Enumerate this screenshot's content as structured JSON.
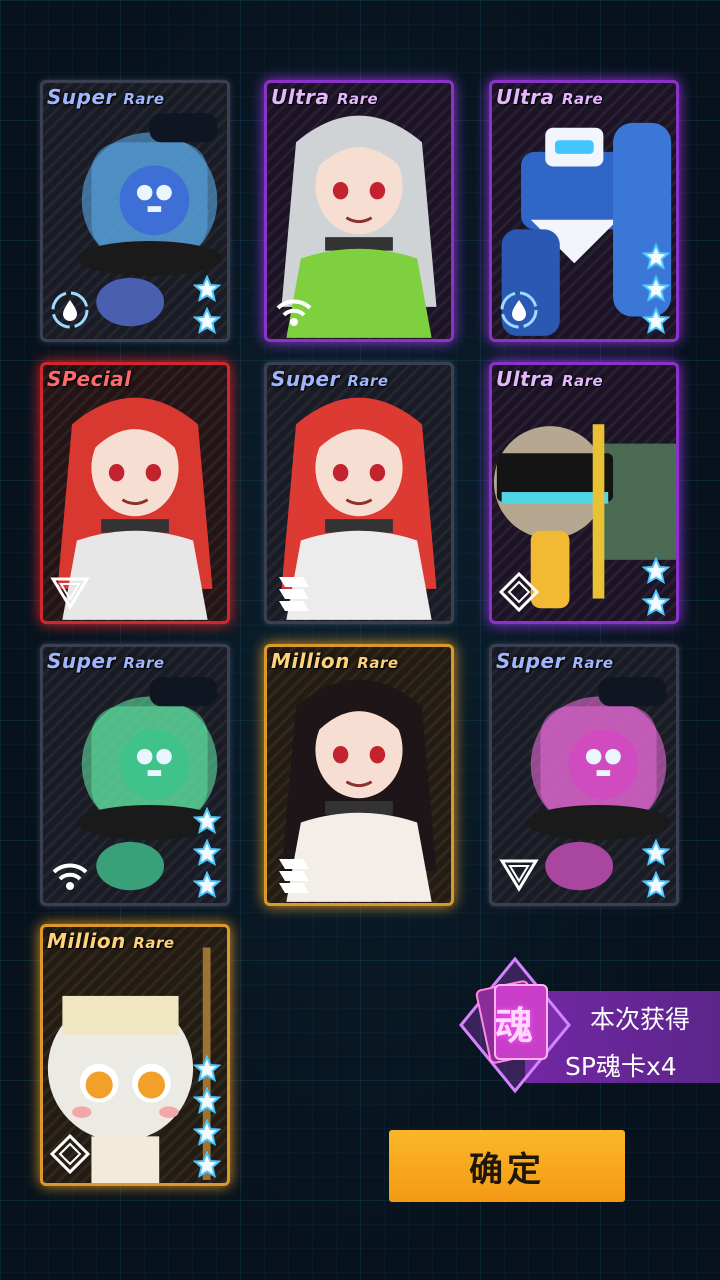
{
  "cards": [
    {
      "rarity_main": "Super",
      "rarity_sub": "Rare",
      "tier": "sr",
      "element_icon": "water-drop-ring-icon",
      "stars": 2,
      "character": "blue-slime-mascot"
    },
    {
      "rarity_main": "Ultra",
      "rarity_sub": "Rare",
      "tier": "ur",
      "element_icon": "wifi-signal-icon",
      "stars": 0,
      "character": "silver-hair-girl"
    },
    {
      "rarity_main": "Ultra",
      "rarity_sub": "Rare",
      "tier": "ur",
      "element_icon": "water-drop-ring-icon",
      "stars": 3,
      "character": "blue-mech"
    },
    {
      "rarity_main": "SPecial",
      "rarity_sub": "",
      "tier": "sp",
      "element_icon": "triangle-down-icon",
      "stars": 0,
      "character": "red-twin-tail-girl"
    },
    {
      "rarity_main": "Super",
      "rarity_sub": "Rare",
      "tier": "sr",
      "element_icon": "striped-banner-icon",
      "stars": 0,
      "character": "red-hair-girl"
    },
    {
      "rarity_main": "Ultra",
      "rarity_sub": "Rare",
      "tier": "ur",
      "element_icon": "diamond-icon",
      "stars": 2,
      "character": "visor-chibi"
    },
    {
      "rarity_main": "Super",
      "rarity_sub": "Rare",
      "tier": "sr",
      "element_icon": "wifi-signal-icon",
      "stars": 3,
      "character": "green-slime-mascot"
    },
    {
      "rarity_main": "Million",
      "rarity_sub": "Rare",
      "tier": "mr",
      "element_icon": "striped-banner-icon",
      "stars": 0,
      "character": "black-hair-girl"
    },
    {
      "rarity_main": "Super",
      "rarity_sub": "Rare",
      "tier": "sr",
      "element_icon": "triangle-down-icon",
      "stars": 2,
      "character": "pink-slime-mascot"
    },
    {
      "rarity_main": "Million",
      "rarity_sub": "Rare",
      "tier": "mr",
      "element_icon": "diamond-icon",
      "stars": 4,
      "character": "white-hair-chibi"
    }
  ],
  "reward": {
    "badge_char": "魂",
    "line1": "本次获得",
    "line2": "SP魂卡x4"
  },
  "confirm_label": "确定",
  "colors": {
    "super_rare": "#3b3f52",
    "ultra_rare": "#8b33c9",
    "special": "#d1262e",
    "million_rare": "#d99a2b",
    "confirm": "#f7a81f"
  }
}
